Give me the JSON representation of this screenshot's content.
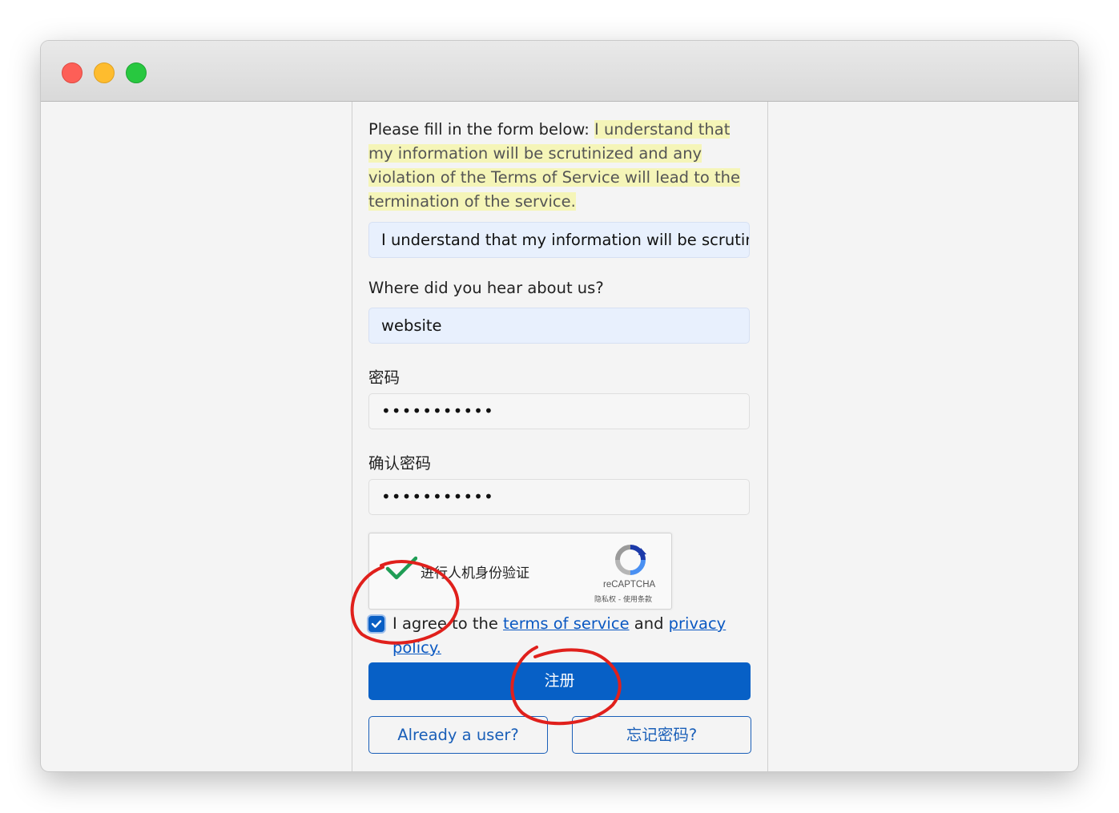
{
  "form": {
    "intro_prefix": "Please fill in the form below: ",
    "intro_highlight": "I understand that my information will be scrutinized and any violation of the Terms of Service will lead to the termination of the service.",
    "statement_value": "I understand that my information will be scrutinized and any violation of the Terms of Service will lead to the termination of the service.",
    "source_label": "Where did you hear about us?",
    "source_value": "website",
    "password_label": "密码",
    "password_value": "•••••••••••",
    "confirm_label": "确认密码",
    "confirm_value": "•••••••••••"
  },
  "captcha": {
    "text": "进行人机身份验证",
    "brand": "reCAPTCHA",
    "terms": "隐私权 - 使用条款",
    "checked": true
  },
  "agree": {
    "checked": true,
    "prefix": "I agree to the ",
    "tos_link": "terms of service",
    "and": " and ",
    "privacy_link": "privacy policy."
  },
  "buttons": {
    "register": "注册",
    "already_user": "Already a user?",
    "forgot_password": "忘记密码?"
  },
  "colors": {
    "accent": "#0760c6",
    "highlight": "#f5f5b8",
    "annotation": "#e0201c",
    "check_green": "#1f9d55"
  }
}
